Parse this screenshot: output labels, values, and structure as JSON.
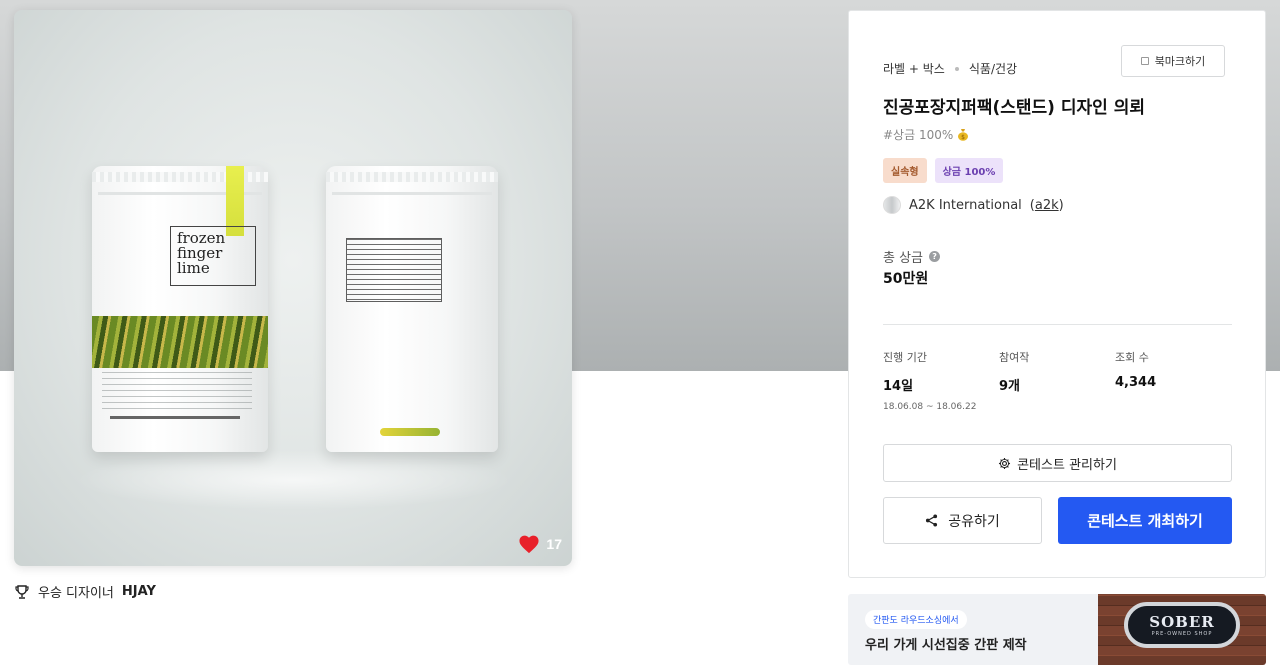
{
  "hero": {
    "likes": "17",
    "pouch_brand_lines": [
      "frozen",
      "finger",
      "lime"
    ],
    "winner_prefix": "우승 디자이너",
    "winner_name": "HJAY"
  },
  "panel": {
    "category_main": "라벨 + 박스",
    "category_sub": "식품/건강",
    "bookmark_label": "북마크하기",
    "title": "진공포장지퍼팩(스탠드) 디자인 의뢰",
    "prize_tag": "#상금 100%",
    "badges": [
      "실속형",
      "상금 100%"
    ],
    "owner_name": "A2K International",
    "owner_handle_open": "(",
    "owner_handle": "a2k",
    "owner_handle_close": ")",
    "total_prize_label": "총 상금",
    "total_prize_value": "50만원",
    "stats": [
      {
        "label": "진행 기간",
        "value": "14일",
        "sub": "18.06.08 ~ 18.06.22"
      },
      {
        "label": "참여작",
        "value": "9개"
      },
      {
        "label": "조회 수",
        "value": "4,344"
      }
    ],
    "manage_label": "콘테스트 관리하기",
    "share_label": "공유하기",
    "host_label": "콘테스트 개최하기"
  },
  "banner": {
    "tag": "간판도 라우드소싱에서",
    "text": "우리 가게 시선집중 간판 제작",
    "sign_main": "SOBER",
    "sign_sub": "PRE-OWNED SHOP"
  },
  "colors": {
    "accent": "#2459f2",
    "badge_practical_bg": "#f8dccc",
    "badge_prize_bg": "#ece2fa",
    "heart": "#e8202a"
  }
}
